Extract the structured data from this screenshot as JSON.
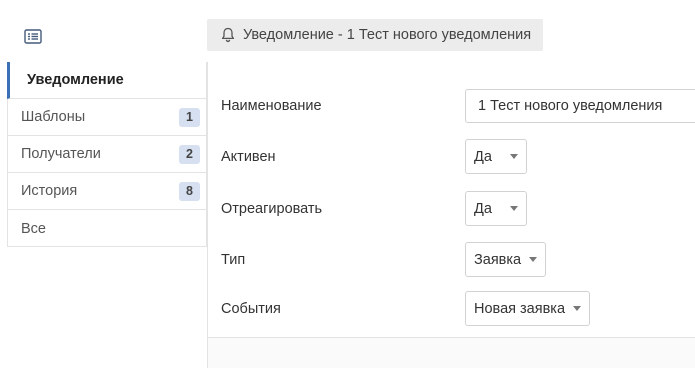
{
  "header": {
    "menu_icon": "list-icon",
    "bell_icon": "bell-icon",
    "title": "Уведомление - 1 Тест нового уведомления"
  },
  "sidebar": {
    "items": [
      {
        "label": "Уведомление",
        "badge": null
      },
      {
        "label": "Шаблоны",
        "badge": "1"
      },
      {
        "label": "Получатели",
        "badge": "2"
      },
      {
        "label": "История",
        "badge": "8"
      },
      {
        "label": "Все",
        "badge": null
      }
    ]
  },
  "form": {
    "name": {
      "label": "Наименование",
      "value": "1 Тест нового уведомления"
    },
    "active": {
      "label": "Активен",
      "value": "Да"
    },
    "react": {
      "label": "Отреагировать",
      "value": "Да"
    },
    "type": {
      "label": "Тип",
      "value": "Заявка"
    },
    "events": {
      "label": "События",
      "value": "Новая заявка"
    }
  },
  "colors": {
    "accent": "#3b6fb6",
    "badge_bg": "#d6e0f0",
    "chip_bg": "#ececec"
  }
}
